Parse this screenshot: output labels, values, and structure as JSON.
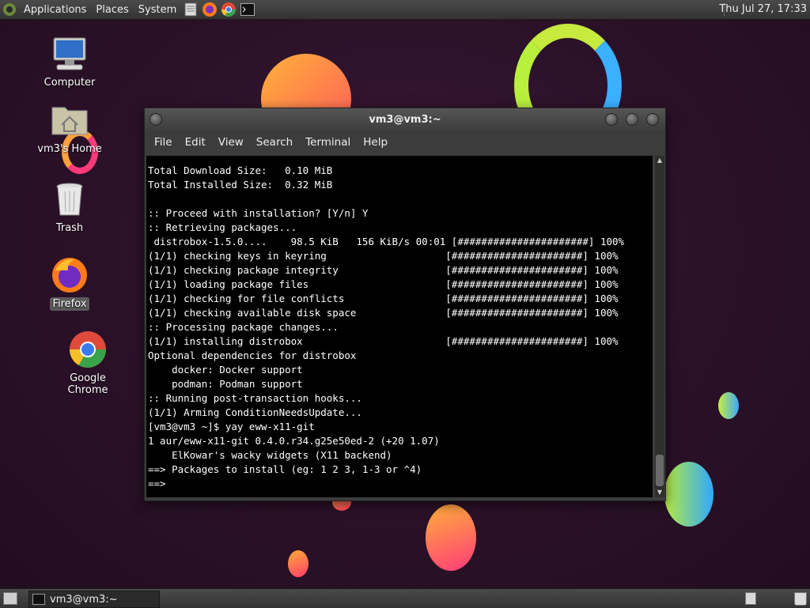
{
  "top_panel": {
    "menus": [
      "Applications",
      "Places",
      "System"
    ],
    "clock": "Thu Jul 27, 17:33"
  },
  "desktop": {
    "icons": [
      {
        "label": "Computer"
      },
      {
        "label": "vm3's Home"
      },
      {
        "label": "Trash"
      },
      {
        "label": "Firefox"
      },
      {
        "label": "Google Chrome"
      }
    ]
  },
  "window": {
    "title": "vm3@vm3:~",
    "menu": [
      "File",
      "Edit",
      "View",
      "Search",
      "Terminal",
      "Help"
    ],
    "terminal_text": "Total Download Size:   0.10 MiB\nTotal Installed Size:  0.32 MiB\n\n:: Proceed with installation? [Y/n] Y\n:: Retrieving packages...\n distrobox-1.5.0....    98.5 KiB   156 KiB/s 00:01 [######################] 100%\n(1/1) checking keys in keyring                    [######################] 100%\n(1/1) checking package integrity                  [######################] 100%\n(1/1) loading package files                       [######################] 100%\n(1/1) checking for file conflicts                 [######################] 100%\n(1/1) checking available disk space               [######################] 100%\n:: Processing package changes...\n(1/1) installing distrobox                        [######################] 100%\nOptional dependencies for distrobox\n    docker: Docker support\n    podman: Podman support\n:: Running post-transaction hooks...\n(1/1) Arming ConditionNeedsUpdate...\n[vm3@vm3 ~]$ yay eww-x11-git\n1 aur/eww-x11-git 0.4.0.r34.g25e50ed-2 (+20 1.07)\n    ElKowar's wacky widgets (X11 backend)\n==> Packages to install (eg: 1 2 3, 1-3 or ^4)\n==> "
  },
  "taskbar": {
    "task_label": "vm3@vm3:~"
  },
  "colors": {
    "terminal_bg": "#000000",
    "terminal_fg": "#ffffff",
    "panel": "#3c3c3c",
    "desktop_bg": "#2a1226"
  }
}
